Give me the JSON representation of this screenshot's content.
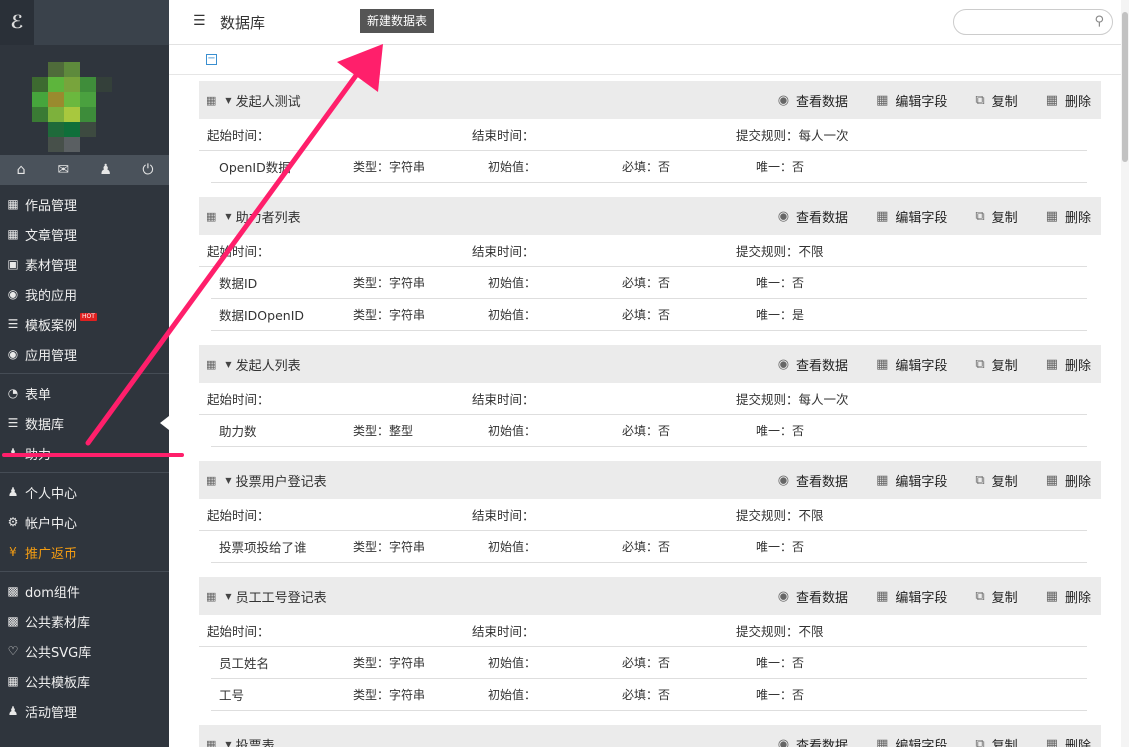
{
  "sidebar": {
    "logo": "ℰ",
    "top_icons": [
      "home-icon",
      "mail-icon",
      "user-icon",
      "power-icon"
    ],
    "sections": [
      {
        "items": [
          {
            "label": "作品管理",
            "icon": "grid-icon"
          },
          {
            "label": "文章管理",
            "icon": "grid-icon"
          },
          {
            "label": "素材管理",
            "icon": "image-icon"
          },
          {
            "label": "我的应用",
            "icon": "app-icon"
          },
          {
            "label": "模板案例",
            "icon": "list-icon",
            "badge": "HOT"
          },
          {
            "label": "应用管理",
            "icon": "app-icon"
          }
        ]
      },
      {
        "items": [
          {
            "label": "表单",
            "icon": "pie-icon"
          },
          {
            "label": "数据库",
            "icon": "database-icon",
            "active": true
          },
          {
            "label": "助力",
            "icon": "users-icon"
          }
        ]
      },
      {
        "items": [
          {
            "label": "个人中心",
            "icon": "user-icon"
          },
          {
            "label": "帐户中心",
            "icon": "gear-icon"
          },
          {
            "label": "推广返币",
            "icon": "yen-icon",
            "highlight": true
          }
        ]
      },
      {
        "items": [
          {
            "label": "dom组件",
            "icon": "briefcase-icon"
          },
          {
            "label": "公共素材库",
            "icon": "briefcase-icon"
          },
          {
            "label": "公共SVG库",
            "icon": "heart-icon"
          },
          {
            "label": "公共模板库",
            "icon": "building-icon"
          },
          {
            "label": "活动管理",
            "icon": "users-icon"
          }
        ]
      }
    ]
  },
  "header": {
    "title": "数据库",
    "new_button": "新建数据表",
    "search_placeholder": ""
  },
  "actions": {
    "view": "查看数据",
    "edit": "编辑字段",
    "copy": "复制",
    "delete": "删除"
  },
  "labels": {
    "start": "起始时间：",
    "end": "结束时间：",
    "rule_prefix": "提交规则：",
    "type_prefix": "类型：",
    "init": "初始值：",
    "required_prefix": "必填：",
    "unique_prefix": "唯一："
  },
  "tables": [
    {
      "name": "发起人测试",
      "rule": "每人一次",
      "fields": [
        {
          "name": "OpenID数据",
          "type": "字符串",
          "required": "否",
          "unique": "否"
        }
      ]
    },
    {
      "name": "助力者列表",
      "rule": "不限",
      "fields": [
        {
          "name": "数据ID",
          "type": "字符串",
          "required": "否",
          "unique": "否"
        },
        {
          "name": "数据IDOpenID",
          "type": "字符串",
          "required": "否",
          "unique": "是"
        }
      ]
    },
    {
      "name": "发起人列表",
      "rule": "每人一次",
      "fields": [
        {
          "name": "助力数",
          "type": "整型",
          "required": "否",
          "unique": "否"
        }
      ]
    },
    {
      "name": "投票用户登记表",
      "rule": "不限",
      "fields": [
        {
          "name": "投票项投给了谁",
          "type": "字符串",
          "required": "否",
          "unique": "否"
        }
      ]
    },
    {
      "name": "员工工号登记表",
      "rule": "不限",
      "fields": [
        {
          "name": "员工姓名",
          "type": "字符串",
          "required": "否",
          "unique": "否"
        },
        {
          "name": "工号",
          "type": "字符串",
          "required": "否",
          "unique": "否"
        }
      ]
    },
    {
      "name": "投票表",
      "rule": "",
      "fields": []
    }
  ],
  "colors": {
    "sidebar_bg": "#2f353d",
    "highlight": "#f39c12",
    "arrow": "#ff1f6b"
  }
}
